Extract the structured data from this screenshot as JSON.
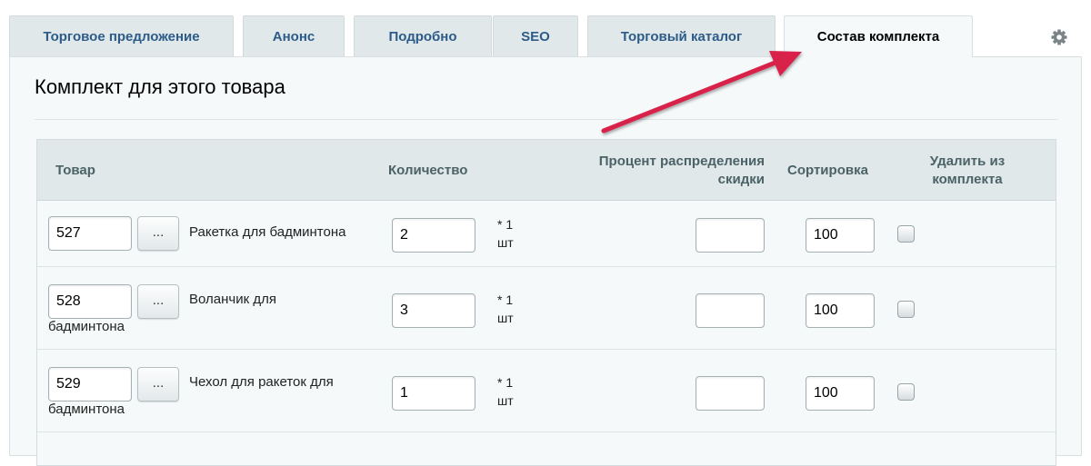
{
  "tabs": [
    {
      "label": "Торговое предложение"
    },
    {
      "label": "Анонс"
    },
    {
      "label": "Подробно"
    },
    {
      "label": "SEO"
    },
    {
      "label": "Торговый каталог"
    },
    {
      "label": "Состав комплекта",
      "active": true
    }
  ],
  "panel": {
    "title": "Комплект для этого товара"
  },
  "table": {
    "headers": {
      "product": "Товар",
      "quantity": "Количество",
      "discount_line1": "Процент распределения",
      "discount_line2": "скидки",
      "sort": "Сортировка",
      "delete_line1": "Удалить из",
      "delete_line2": "комплекта"
    },
    "browse_label": "...",
    "unit_line1": "* 1",
    "unit_line2": "шт",
    "rows": [
      {
        "id": "527",
        "name_line1": "Ракетка для бадминтона",
        "name_line2": "",
        "quantity": "2",
        "discount": "",
        "sort": "100",
        "delete": false
      },
      {
        "id": "528",
        "name_line1": "Воланчик для",
        "name_line2": "бадминтона",
        "quantity": "3",
        "discount": "",
        "sort": "100",
        "delete": false
      },
      {
        "id": "529",
        "name_line1": "Чехол для ракеток для",
        "name_line2": "бадминтона",
        "quantity": "1",
        "discount": "",
        "sort": "100",
        "delete": false
      }
    ]
  },
  "colors": {
    "tab_text": "#2d5c88",
    "tab_bg": "#e0e8ea",
    "panel_bg": "#f5f9f9",
    "arrow": "#d8204a"
  }
}
